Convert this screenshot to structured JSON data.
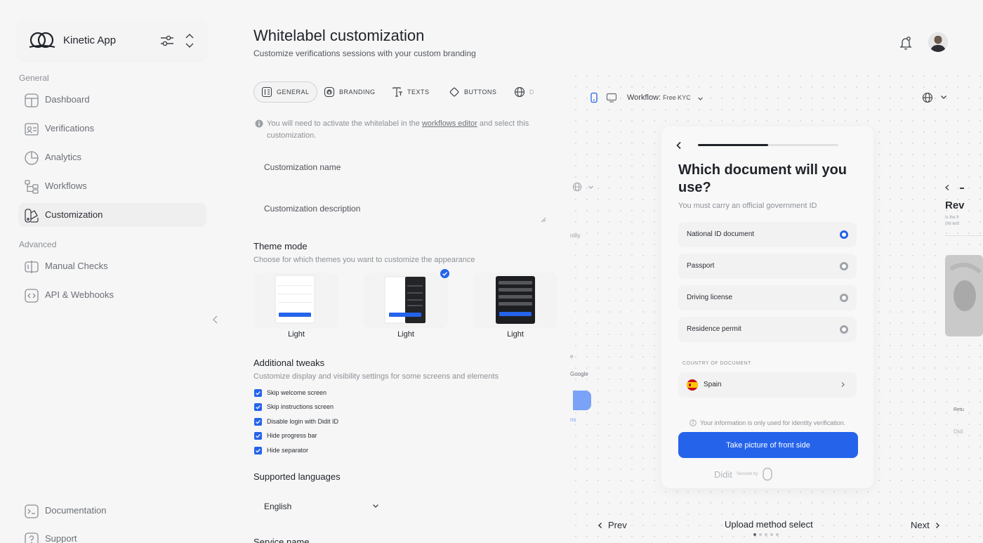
{
  "brand": {
    "name": "Kinetic App"
  },
  "sidebar": {
    "general_label": "General",
    "advanced_label": "Advanced",
    "general_items": [
      {
        "label": "Dashboard"
      },
      {
        "label": "Verifications"
      },
      {
        "label": "Analytics"
      },
      {
        "label": "Workflows"
      },
      {
        "label": "Customization"
      }
    ],
    "advanced_items": [
      {
        "label": "Manual Checks"
      },
      {
        "label": "API & Webhooks"
      }
    ],
    "footer_items": [
      {
        "label": "Documentation"
      },
      {
        "label": "Support"
      }
    ]
  },
  "header": {
    "title": "Whitelabel customization",
    "subtitle": "Customize verifications sessions with your custom branding"
  },
  "tabs": [
    {
      "label": "GENERAL"
    },
    {
      "label": "BRANDING"
    },
    {
      "label": "TEXTS"
    },
    {
      "label": "BUTTONS"
    },
    {
      "label": "D"
    }
  ],
  "notice": {
    "before": "You will need to activate the whitelabel in the ",
    "link": "workflows editor",
    "after": " and select this customization."
  },
  "form": {
    "name_placeholder": "Customization name",
    "description_placeholder": "Customization description"
  },
  "theme": {
    "title": "Theme mode",
    "description": "Choose for which themes you want to customize the appearance",
    "options": [
      {
        "label": "Light"
      },
      {
        "label": "Light"
      },
      {
        "label": "Light"
      }
    ]
  },
  "tweaks": {
    "title": "Additional tweaks",
    "description": "Customize display and visibility settings for some screens and elements",
    "items": [
      {
        "label": "Skip welcome screen",
        "checked": true
      },
      {
        "label": "Skip instructions screen",
        "checked": true
      },
      {
        "label": "Disable login with Didit ID",
        "checked": true
      },
      {
        "label": "Hide progress bar",
        "checked": true
      },
      {
        "label": "Hide separator",
        "checked": true
      }
    ]
  },
  "languages": {
    "title": "Supported languages",
    "selected": "English"
  },
  "service": {
    "title": "Service name"
  },
  "preview": {
    "workflow_label": "Workflow:",
    "workflow_value": "Free KYC",
    "ghost_left": [
      "ntity",
      "e",
      "Google",
      "ns"
    ],
    "question": "Which document will you use?",
    "question_sub": "You must carry an official government ID",
    "progress": 0.5,
    "options": [
      {
        "label": "National ID document",
        "selected": true
      },
      {
        "label": "Passport",
        "selected": false
      },
      {
        "label": "Driving license",
        "selected": false
      },
      {
        "label": "Residence permit",
        "selected": false
      }
    ],
    "country_label": "COUNTRY OF DOCUMENT",
    "country_value": "Spain",
    "privacy": "Your information is only used for identity verification.",
    "cta": "Take picture of front side",
    "secured_brand": "Didit",
    "secured_text": "Secured by",
    "right_peek_title": "Rev",
    "right_peek_sub": "Is the fr (All text",
    "right_peek_misc": [
      "Retu",
      "Didi"
    ],
    "prev": "Prev",
    "next": "Next",
    "step_title": "Upload method select",
    "dots": 5,
    "active_dot": 0
  },
  "colors": {
    "accent": "#2563eb",
    "text": "#1f2329",
    "muted": "#8d9197"
  }
}
